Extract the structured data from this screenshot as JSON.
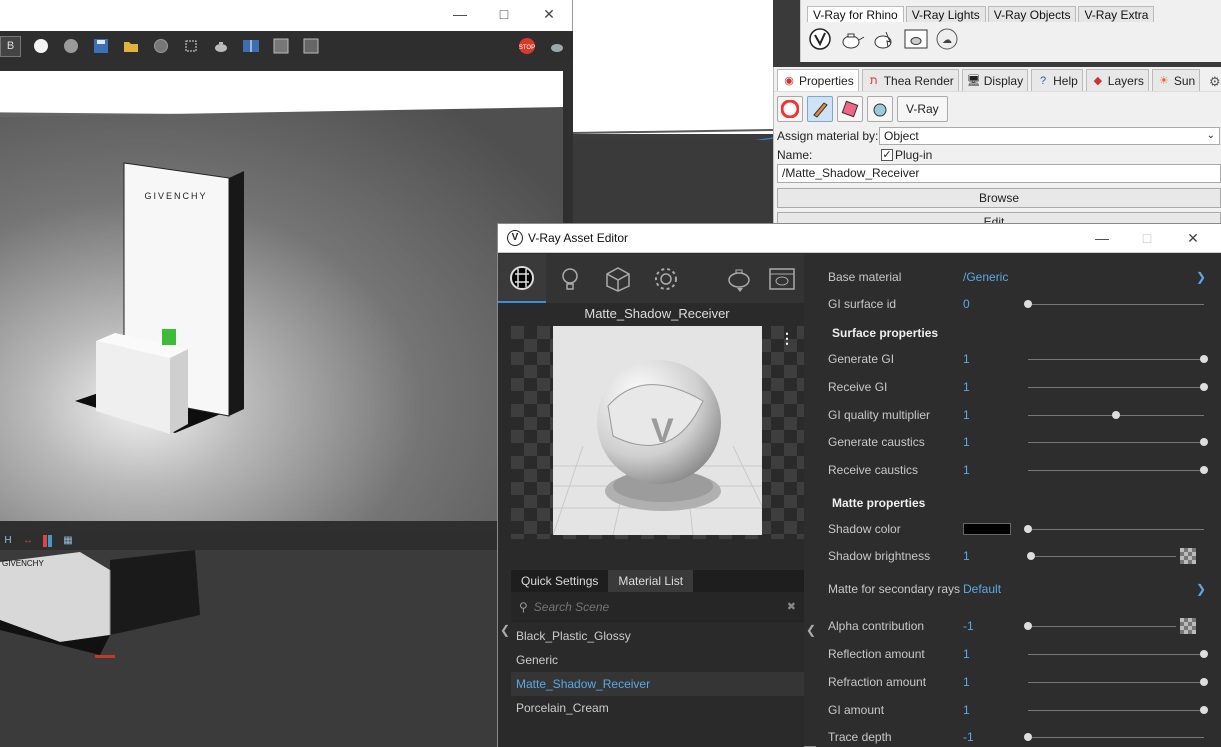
{
  "render_window": {
    "status_icons": [
      "H",
      "resize-icon",
      "flag-icon",
      "grid-icon"
    ],
    "brand_text": "GIVENCHY"
  },
  "vray_toolbar": {
    "tabs": [
      "V-Ray for Rhino",
      "V-Ray Lights",
      "V-Ray Objects",
      "V-Ray Extra"
    ]
  },
  "properties_panel": {
    "tabs": [
      {
        "label": "Properties",
        "icon": "properties-icon"
      },
      {
        "label": "Thea Render",
        "icon": "thea-icon"
      },
      {
        "label": "Display",
        "icon": "display-icon"
      },
      {
        "label": "Help",
        "icon": "help-icon"
      },
      {
        "label": "Layers",
        "icon": "layers-icon"
      },
      {
        "label": "Sun",
        "icon": "sun-icon"
      }
    ],
    "vray_button": "V-Ray",
    "assign_material_label": "Assign material by:",
    "assign_material_value": "Object",
    "name_label": "Name:",
    "plugin_label": "Plug-in",
    "plugin_checked": true,
    "material_name": "/Matte_Shadow_Receiver",
    "browse_label": "Browse",
    "edit_label": "Edit..."
  },
  "asset_editor": {
    "title": "V-Ray Asset Editor",
    "preview_title": "Matte_Shadow_Receiver",
    "subtabs": [
      "Quick Settings",
      "Material List"
    ],
    "search_placeholder": "Search Scene",
    "materials": [
      "Black_Plastic_Glossy",
      "Generic",
      "Matte_Shadow_Receiver",
      "Porcelain_Cream"
    ],
    "selected_material": "Matte_Shadow_Receiver",
    "properties": {
      "base_material": {
        "label": "Base material",
        "value": "/Generic"
      },
      "gi_surface_id": {
        "label": "GI surface id",
        "value": "0"
      },
      "surface_heading": "Surface properties",
      "generate_gi": {
        "label": "Generate GI",
        "value": "1",
        "level": 1.0
      },
      "receive_gi": {
        "label": "Receive GI",
        "value": "1",
        "level": 1.0
      },
      "gi_quality": {
        "label": "GI quality multiplier",
        "value": "1",
        "level": 0.5
      },
      "generate_caustics": {
        "label": "Generate caustics",
        "value": "1",
        "level": 1.0
      },
      "receive_caustics": {
        "label": "Receive caustics",
        "value": "1",
        "level": 1.0
      },
      "matte_heading": "Matte properties",
      "shadow_color": {
        "label": "Shadow color",
        "color": "#000000"
      },
      "shadow_brightness": {
        "label": "Shadow brightness",
        "value": "1"
      },
      "matte_secondary": {
        "label": "Matte for secondary rays",
        "value": "Default"
      },
      "alpha_contribution": {
        "label": "Alpha contribution",
        "value": "-1"
      },
      "reflection_amount": {
        "label": "Reflection amount",
        "value": "1",
        "level": 1.0
      },
      "refraction_amount": {
        "label": "Refraction amount",
        "value": "1",
        "level": 1.0
      },
      "gi_amount": {
        "label": "GI amount",
        "value": "1",
        "level": 1.0
      },
      "trace_depth": {
        "label": "Trace depth",
        "value": "-1"
      }
    }
  },
  "colors": {
    "accent": "#5aa9e6",
    "editor_bg": "#2d2d2d",
    "stop_button": "#d83a2a"
  }
}
